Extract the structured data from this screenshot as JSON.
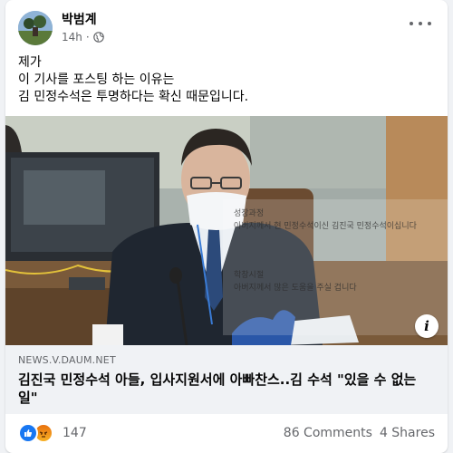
{
  "post": {
    "author": "박범계",
    "time": "14h",
    "privacy_icon": "globe-icon",
    "menu_icon": "more-dots-icon",
    "text_lines": [
      "제가",
      "이 기사를 포스팅 하는 이유는",
      "김 민정수석은 투명하다는 확신 때문입니다."
    ]
  },
  "link": {
    "domain": "NEWS.V.DAUM.NET",
    "title": "김진국 민정수석 아들, 입사지원서에 아빠찬스..김 수석 \"있을 수 없는 일\"",
    "info_icon": "i"
  },
  "media": {
    "overlay_lines": [
      "성장과정",
      "아버지께서 현 민정수석이신 김진국 민정수석이십니다",
      "학창시절",
      "아버지께서 많은 도움을 주실 겁니다"
    ]
  },
  "engagement": {
    "reaction_icons": [
      "like-icon",
      "angry-icon"
    ],
    "reactions": "147",
    "comments": "86 Comments",
    "shares": "4 Shares"
  },
  "colors": {
    "brand_blue": "#1877f2",
    "muted_text": "#65676b",
    "link_bg": "#f0f2f5"
  }
}
